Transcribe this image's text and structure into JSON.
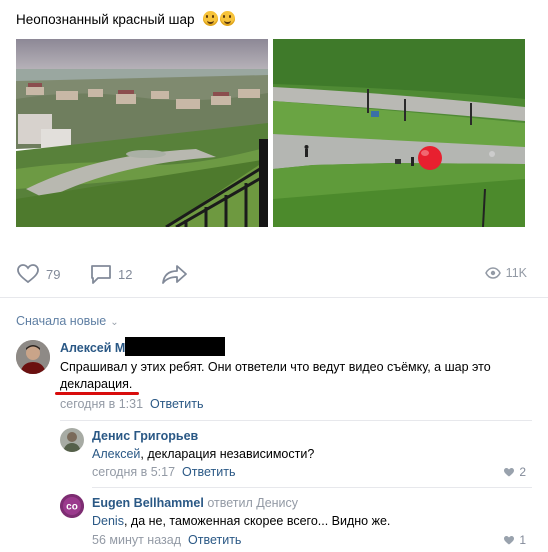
{
  "post": {
    "text": "Неопознанный красный шар",
    "emojis": [
      "grinning-face",
      "grinning-face"
    ]
  },
  "actions": {
    "likes": "79",
    "comments": "12",
    "views": "11K"
  },
  "comments_sort": "Сначала новые",
  "comments": [
    {
      "author": "Алексей М",
      "text_line1": "Спрашивал у этих ребят. Они ответели что ведут видео съёмку, а шар это",
      "text_line2": "декларация.",
      "time": "сегодня в 1:31",
      "reply": "Ответить"
    },
    {
      "author": "Денис Григорьев",
      "addressee": "Алексей",
      "text": ", декларация независимости?",
      "time": "сегодня в 5:17",
      "reply": "Ответить",
      "likes": "2"
    },
    {
      "author": "Eugen Bellhammel",
      "replied": "ответил Денису",
      "addressee": "Denis",
      "text": ", да не, таможенная скорее всего... Видно же.",
      "time": "56 минут назад",
      "reply": "Ответить",
      "likes": "1",
      "avatar_text": "co"
    }
  ],
  "colors": {
    "link": "#2a5885",
    "meta": "#939aa5",
    "highlight": "#d80c0c",
    "balloon": "#e8202f"
  }
}
